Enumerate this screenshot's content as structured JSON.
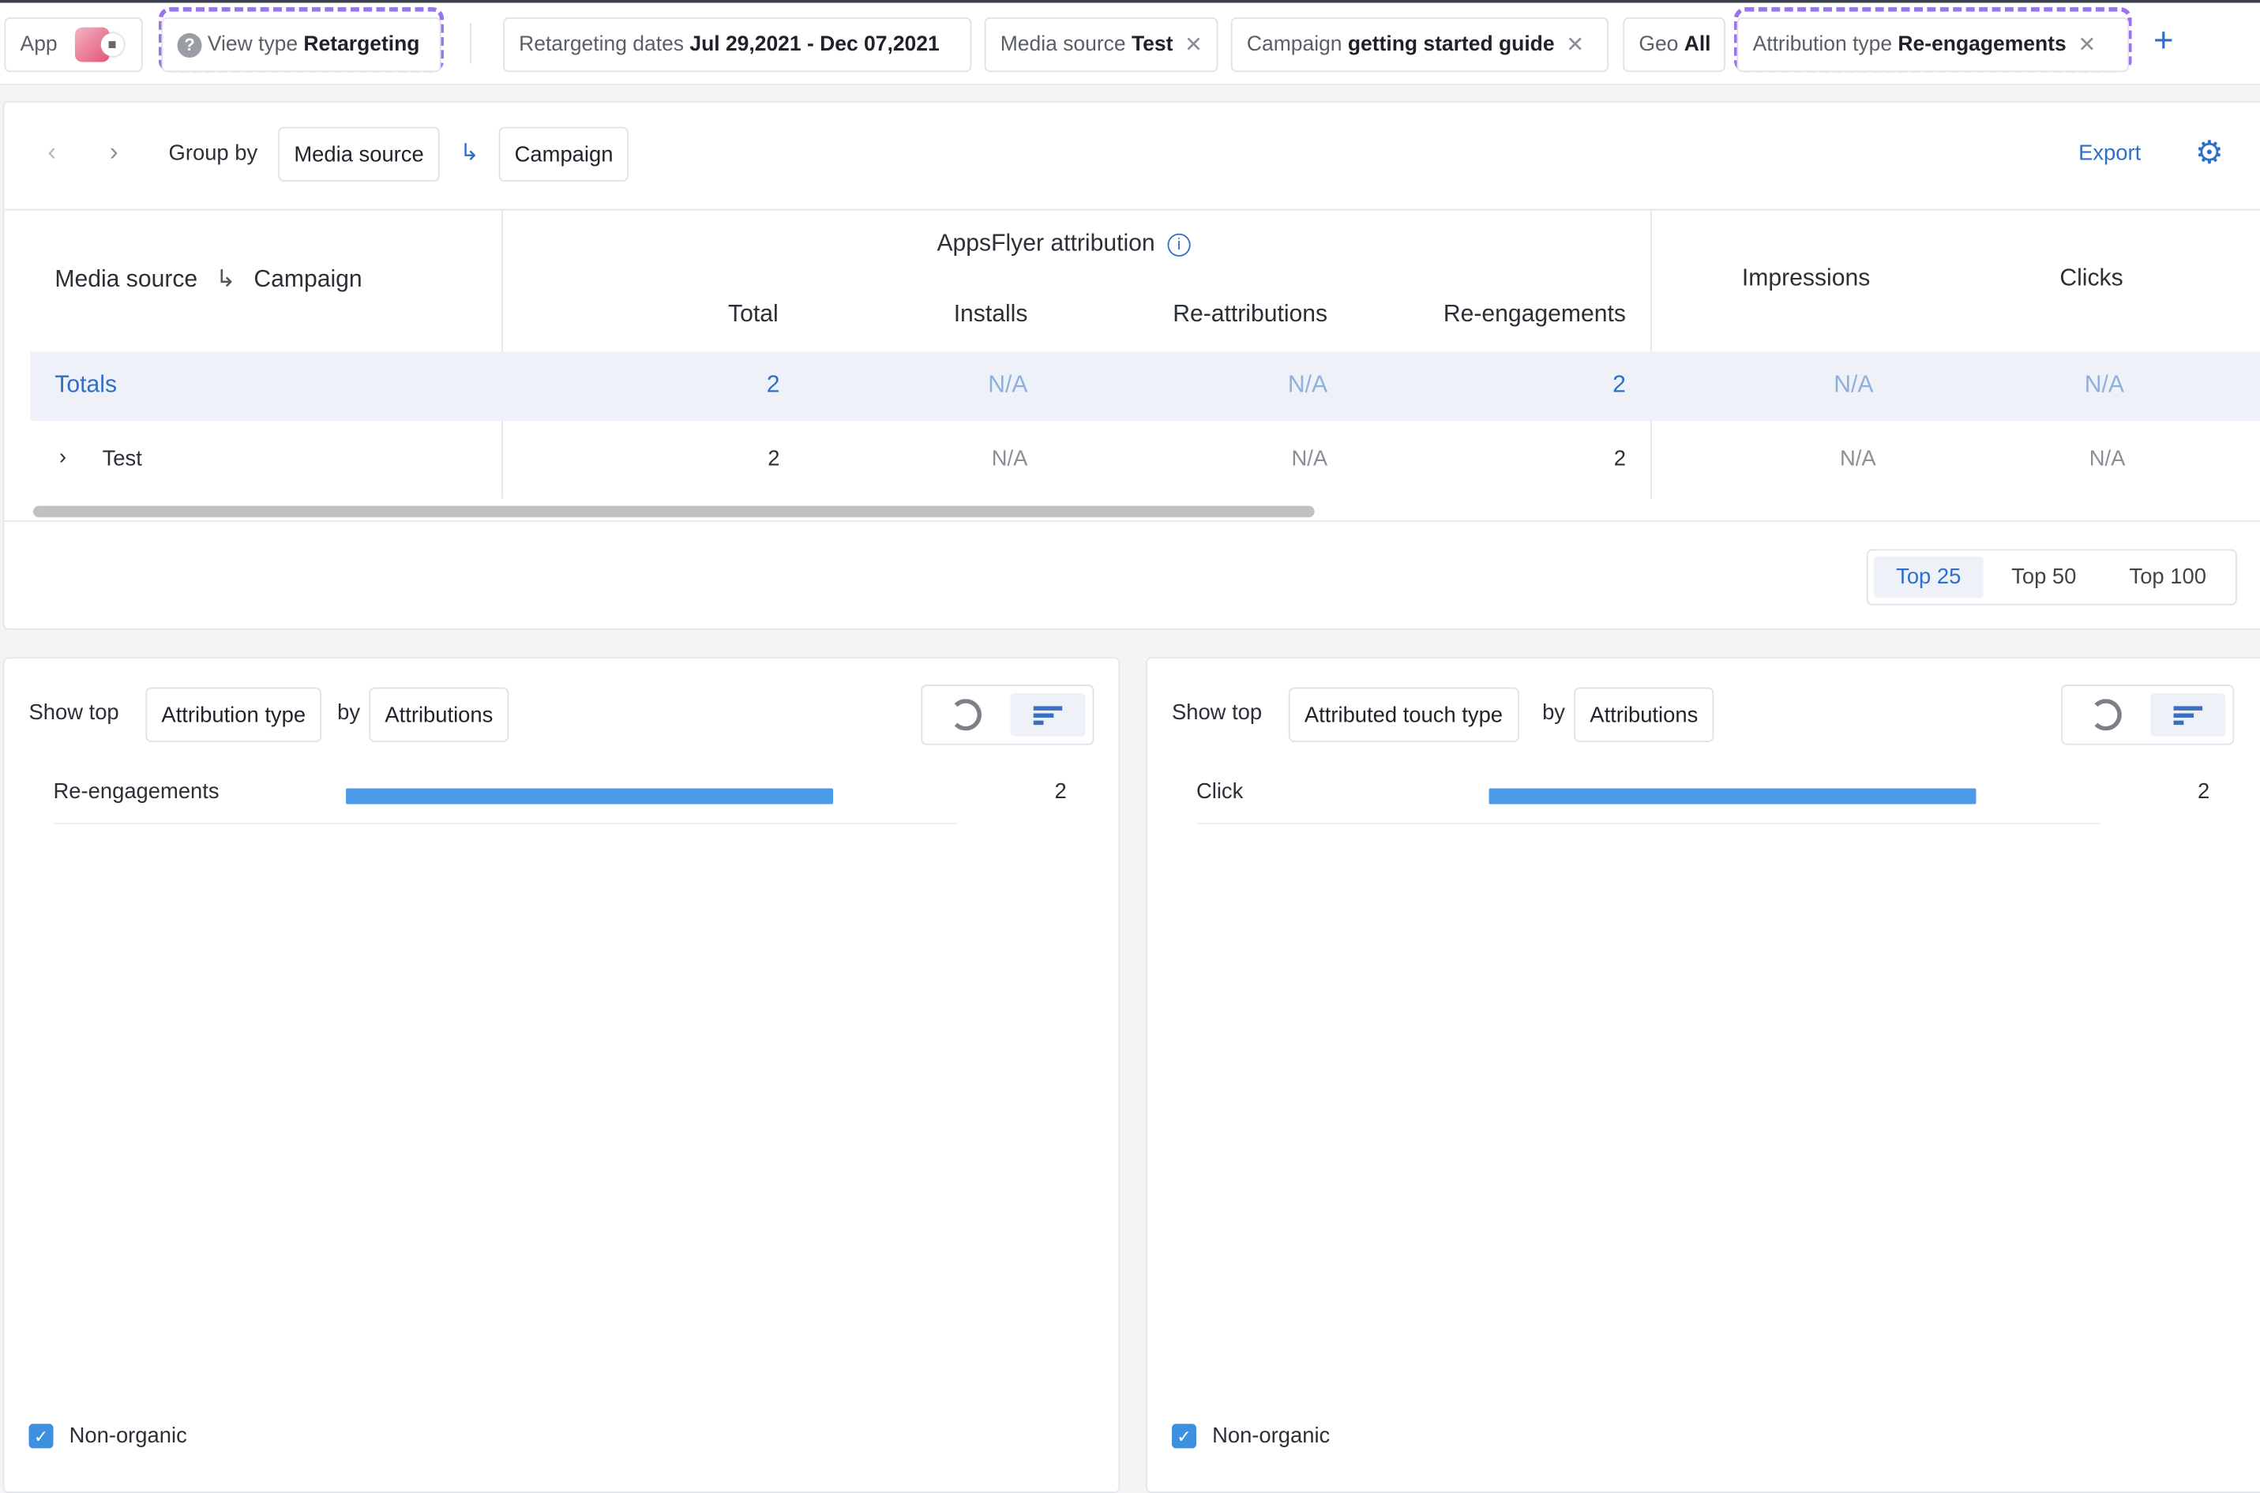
{
  "filters": {
    "app_label": "App",
    "view_type": {
      "label": "View type",
      "value": "Retargeting"
    },
    "retargeting_dates": {
      "label": "Retargeting dates",
      "value": "Jul 29,2021 - Dec 07,2021"
    },
    "media_source": {
      "label": "Media source",
      "value": "Test"
    },
    "campaign": {
      "label": "Campaign",
      "value": "getting started guide"
    },
    "geo": {
      "label": "Geo",
      "value": "All"
    },
    "attribution_type": {
      "label": "Attribution type",
      "value": "Re-engagements"
    },
    "add_icon": "plus-icon",
    "highlight_color": "#9a72f2"
  },
  "toolbar": {
    "group_by_label": "Group by",
    "group_by": [
      "Media source",
      "Campaign"
    ],
    "export_label": "Export"
  },
  "table": {
    "first_col_header": [
      "Media source",
      "Campaign"
    ],
    "group_header": "AppsFlyer attribution",
    "sub_headers": [
      "Total",
      "Installs",
      "Re-attributions",
      "Re-engagements"
    ],
    "extra_headers": [
      "Impressions",
      "Clicks"
    ],
    "totals": {
      "label": "Totals",
      "values": [
        "2",
        "N/A",
        "N/A",
        "2",
        "N/A",
        "N/A"
      ]
    },
    "rows": [
      {
        "label": "Test",
        "values": [
          "2",
          "N/A",
          "N/A",
          "2",
          "N/A",
          "N/A"
        ]
      }
    ],
    "scroll_fraction_visible": 0.57
  },
  "top_options": {
    "items": [
      "Top 25",
      "Top 50",
      "Top 100"
    ],
    "selected": "Top 25"
  },
  "panels": [
    {
      "show_top_label": "Show top",
      "dimension": "Attribution type",
      "by_label": "by",
      "metric": "Attributions",
      "view": "bar",
      "rows": [
        {
          "label": "Re-engagements",
          "value": 2
        }
      ],
      "checkbox_label": "Non-organic",
      "checked": true
    },
    {
      "show_top_label": "Show top",
      "dimension": "Attributed touch type",
      "by_label": "by",
      "metric": "Attributions",
      "view": "bar",
      "rows": [
        {
          "label": "Click",
          "value": 2
        }
      ],
      "checkbox_label": "Non-organic",
      "checked": true
    }
  ],
  "colors": {
    "accent": "#2f6fc9",
    "bar": "#4c9be8",
    "totals_bg": "#eef2f8"
  }
}
